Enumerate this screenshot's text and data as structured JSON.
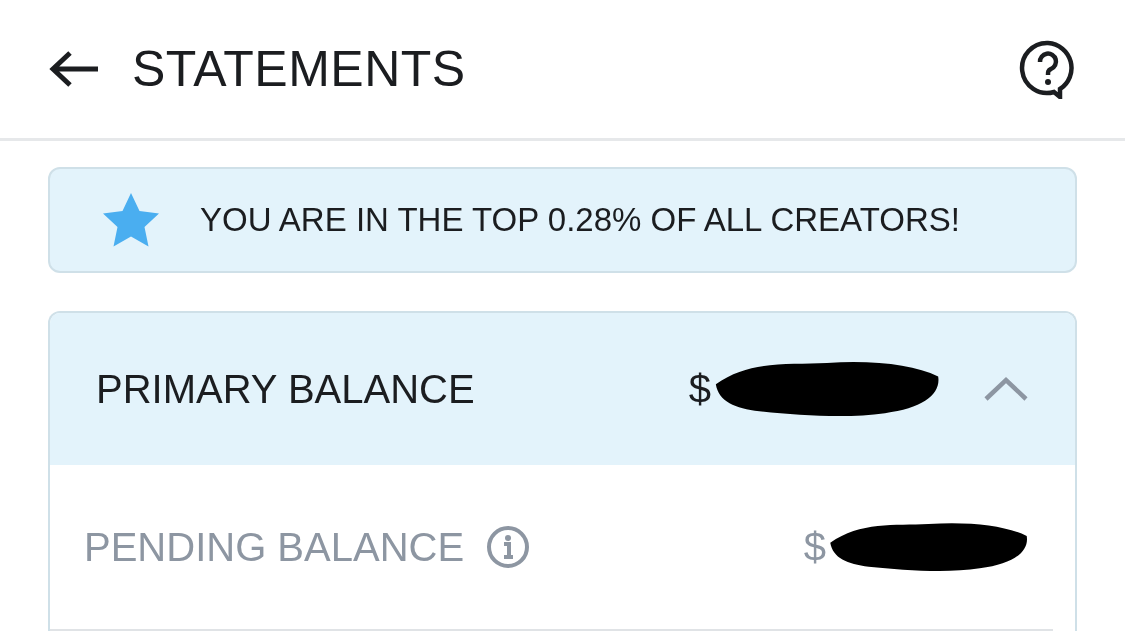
{
  "header": {
    "title": "STATEMENTS"
  },
  "banner": {
    "text": "YOU ARE IN THE TOP 0.28% OF ALL CREATORS!"
  },
  "balances": {
    "expanded": true,
    "primary": {
      "label": "PRIMARY BALANCE",
      "amount": "$"
    },
    "pending": {
      "label": "PENDING BALANCE",
      "amount": "$"
    }
  }
}
